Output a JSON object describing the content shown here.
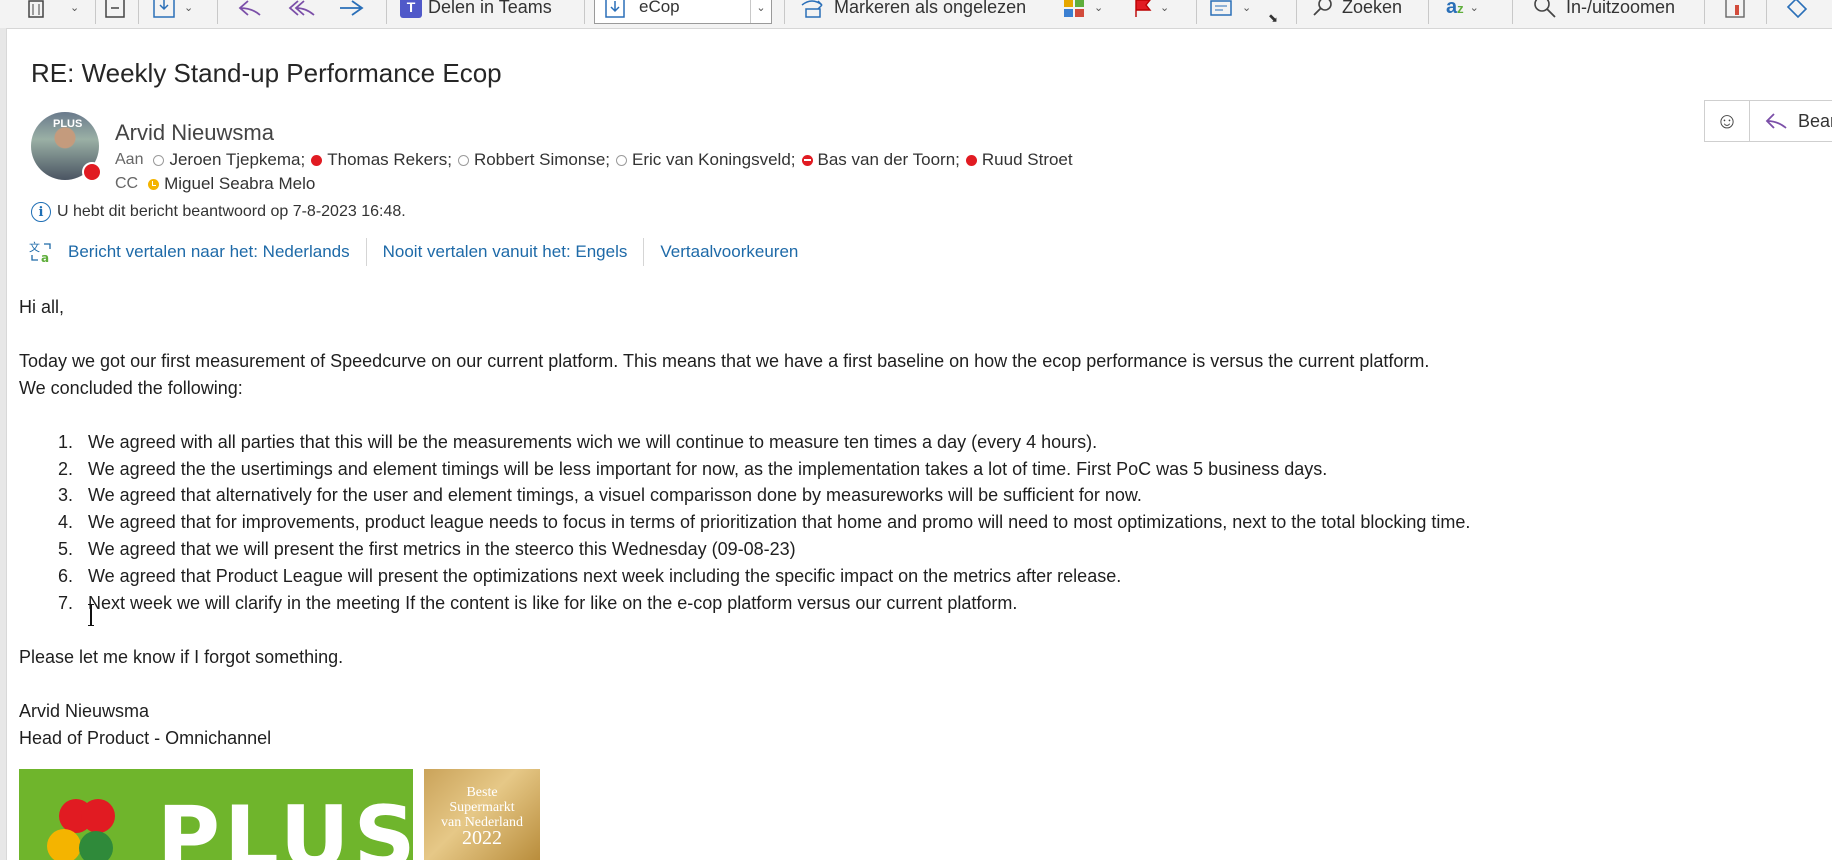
{
  "ribbon": {
    "share_teams": "Delen in Teams",
    "folder_combo": "eCop",
    "mark_unread": "Markeren als ongelezen",
    "search": "Zoeken",
    "zoom": "In-/uitzoomen"
  },
  "email": {
    "subject": "RE: Weekly Stand-up Performance Ecop",
    "sender": "Arvid Nieuwsma",
    "to_label": "Aan",
    "to": [
      {
        "name": "Jeroen Tjepkema;",
        "status": "offline"
      },
      {
        "name": "Thomas Rekers;",
        "status": "busy"
      },
      {
        "name": "Robbert Simonse;",
        "status": "offline"
      },
      {
        "name": "Eric van Koningsveld;",
        "status": "offline"
      },
      {
        "name": "Bas van der Toorn;",
        "status": "do-not-disturb"
      },
      {
        "name": "Ruud Stroet",
        "status": "busy"
      }
    ],
    "cc_label": "CC",
    "cc": [
      {
        "name": "Miguel Seabra Melo",
        "status": "away"
      }
    ],
    "info": "U hebt dit bericht beantwoord op 7-8-2023 16:48.",
    "reply_button": "Bean",
    "translate": {
      "translate_link": "Bericht vertalen naar het: Nederlands",
      "never_link": "Nooit vertalen vanuit het: Engels",
      "prefs_link": "Vertaalvoorkeuren"
    },
    "body": {
      "greeting": "Hi all,",
      "intro1": "Today we got our first measurement of Speedcurve on our current platform. This means that we have a first baseline on how the ecop performance is versus the current platform.",
      "intro2": "We concluded the following:",
      "items": [
        {
          "num": "1.",
          "text": "We agreed with all parties that this will be the measurements wich we will continue to measure ten times a day (every 4 hours)."
        },
        {
          "num": "2.",
          "text": "We agreed the the usertimings and element timings will be less important for now, as the implementation takes a lot of time. First PoC was 5 business days."
        },
        {
          "num": "3.",
          "text": "We agreed that alternatively for the user and element timings, a visuel comparisson done by measureworks will be sufficient for now."
        },
        {
          "num": "4.",
          "text": "We agreed that for improvements, product league needs to focus in terms of prioritization that home and promo will need to most optimizations, next to the total blocking time."
        },
        {
          "num": "5.",
          "text": "We agreed that we will present the first metrics in the steerco this Wednesday (09-08-23)"
        },
        {
          "num": "6.",
          "text": "We agreed that Product League will present the optimizations next week including the specific impact on the metrics after release."
        },
        {
          "num": "7.",
          "text": "Next week we will clarify in the meeting If the content is like for like on the e-cop platform versus our current platform."
        }
      ],
      "closing": "Please let me know if I forgot something.",
      "sig_name": "Arvid Nieuwsma",
      "sig_title": "Head of Product - Omnichannel"
    },
    "logo": {
      "plus_text": "PLUS",
      "avatar_text": "PLUS",
      "award_line1": "Beste",
      "award_line2": "Supermarkt",
      "award_line3": "van Nederland",
      "award_year": "2022"
    }
  },
  "colors": {
    "link": "#1e6aa8",
    "plus_green": "#6fb52c",
    "presence_busy": "#e11b22",
    "presence_away": "#f4b400"
  }
}
